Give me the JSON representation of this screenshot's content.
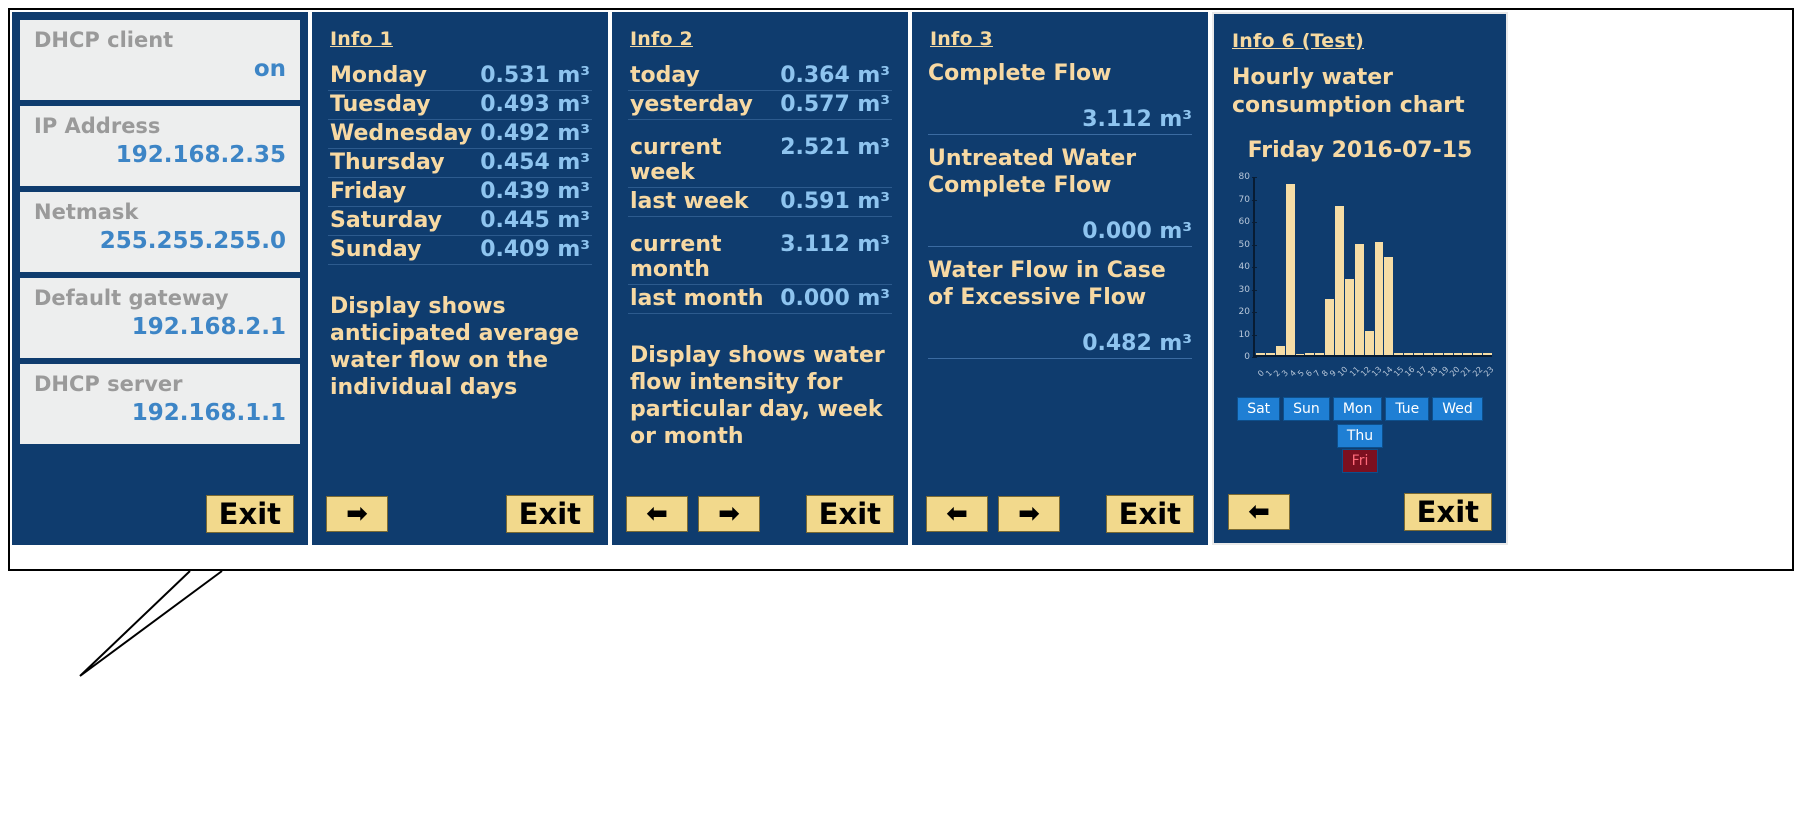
{
  "network_panel": {
    "cards": [
      {
        "label": "DHCP client",
        "value": "on"
      },
      {
        "label": "IP Address",
        "value": "192.168.2.35"
      },
      {
        "label": "Netmask",
        "value": "255.255.255.0"
      },
      {
        "label": "Default gateway",
        "value": "192.168.2.1"
      },
      {
        "label": "DHCP server",
        "value": "192.168.1.1"
      }
    ],
    "exit_label": "Exit"
  },
  "info1": {
    "title": "Info 1",
    "rows": [
      {
        "key": "Monday",
        "value": "0.531 m³"
      },
      {
        "key": "Tuesday",
        "value": "0.493 m³"
      },
      {
        "key": "Wednesday",
        "value": "0.492 m³"
      },
      {
        "key": "Thursday",
        "value": "0.454 m³"
      },
      {
        "key": "Friday",
        "value": "0.439 m³"
      },
      {
        "key": "Saturday",
        "value": "0.445 m³"
      },
      {
        "key": "Sunday",
        "value": "0.409 m³"
      }
    ],
    "note": "Display shows anticipated average water flow on the individual days",
    "next_label": "➡",
    "exit_label": "Exit"
  },
  "info2": {
    "title": "Info 2",
    "group1": [
      {
        "key": "today",
        "value": "0.364 m³"
      },
      {
        "key": "yesterday",
        "value": "0.577 m³"
      }
    ],
    "group2": [
      {
        "key": "current week",
        "value": "2.521 m³"
      },
      {
        "key": "last week",
        "value": "0.591 m³"
      }
    ],
    "group3": [
      {
        "key": "current month",
        "value": "3.112 m³"
      },
      {
        "key": "last month",
        "value": "0.000 m³"
      }
    ],
    "note": "Display shows water flow intensity for particular day, week or month",
    "prev_label": "⬅",
    "next_label": "➡",
    "exit_label": "Exit"
  },
  "info3": {
    "title": "Info 3",
    "blocks": [
      {
        "label": "Complete Flow",
        "value": "3.112 m³"
      },
      {
        "label": "Untreated Water Complete Flow",
        "value": "0.000 m³"
      },
      {
        "label": "Water Flow in Case of Excessive Flow",
        "value": "0.482 m³"
      }
    ],
    "prev_label": "⬅",
    "next_label": "➡",
    "exit_label": "Exit"
  },
  "info6": {
    "title": "Info 6 (Test)",
    "heading": "Hourly water consumption chart",
    "date": "Friday 2016-07-15",
    "day_buttons": [
      {
        "label": "Sat",
        "selected": false
      },
      {
        "label": "Sun",
        "selected": false
      },
      {
        "label": "Mon",
        "selected": false
      },
      {
        "label": "Tue",
        "selected": false
      },
      {
        "label": "Wed",
        "selected": false
      },
      {
        "label": "Thu",
        "selected": false
      }
    ],
    "selected_day": {
      "label": "Fri",
      "selected": true
    },
    "prev_label": "⬅",
    "exit_label": "Exit"
  },
  "chart_data": {
    "type": "bar",
    "title": "Hourly water consumption chart",
    "subtitle": "Friday 2016-07-15",
    "xlabel": "",
    "ylabel": "",
    "ylim": [
      0,
      80
    ],
    "yticks": [
      0,
      10,
      20,
      30,
      40,
      50,
      60,
      70,
      80
    ],
    "grid": false,
    "legend": "none",
    "categories": [
      "0",
      "1",
      "2",
      "3",
      "4",
      "5",
      "6",
      "7",
      "8",
      "9",
      "10",
      "11",
      "12",
      "13",
      "14",
      "15",
      "16",
      "17",
      "18",
      "19",
      "20",
      "21",
      "22",
      "23"
    ],
    "values": [
      1,
      1,
      4,
      77,
      0,
      1,
      1,
      25,
      67,
      34,
      50,
      11,
      51,
      44,
      1,
      1,
      1,
      1,
      1,
      1,
      1,
      1,
      1,
      1
    ],
    "bar_color": "#f6dda6"
  },
  "colors": {
    "panel_bg": "#0f3c6e",
    "label": "#f7d9a3",
    "value": "#8ec4ef",
    "button": "#f2d98c",
    "card_bg": "#edeeee",
    "card_label": "#9a9a9a",
    "card_value": "#3d85c6",
    "day_button": "#1f7fd4",
    "day_selected": "#7c1020"
  }
}
